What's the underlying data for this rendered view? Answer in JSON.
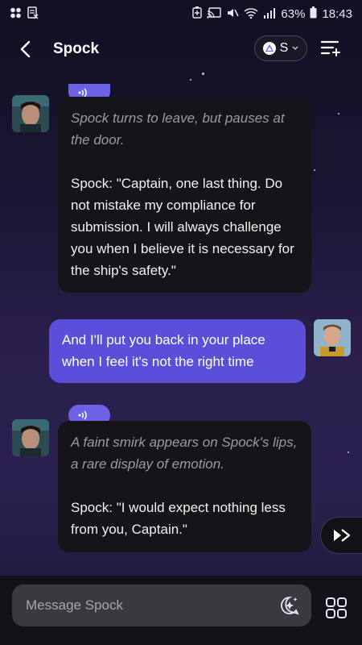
{
  "status_bar": {
    "battery": "63%",
    "time": "18:43"
  },
  "header": {
    "title": "Spock",
    "persona_letter": "S"
  },
  "messages": [
    {
      "narration": "Spock turns to leave, but pauses at the door.",
      "speech": "Spock: \"Captain, one last thing. Do not mistake my compliance for submission. I will always challenge you when I believe it is necessary for the ship's safety.\""
    },
    {
      "user_text": "And I'll put you back in your place when I feel it's not the right time"
    },
    {
      "narration": "A faint smirk appears on Spock's lips, a rare display of emotion.",
      "speech": "Spock: \"I would expect nothing less from you, Captain.\""
    }
  ],
  "composer": {
    "placeholder": "Message Spock"
  },
  "colors": {
    "accent": "#6d62e6",
    "user_bubble": "#5a4fd8",
    "bot_bubble": "#151419"
  }
}
